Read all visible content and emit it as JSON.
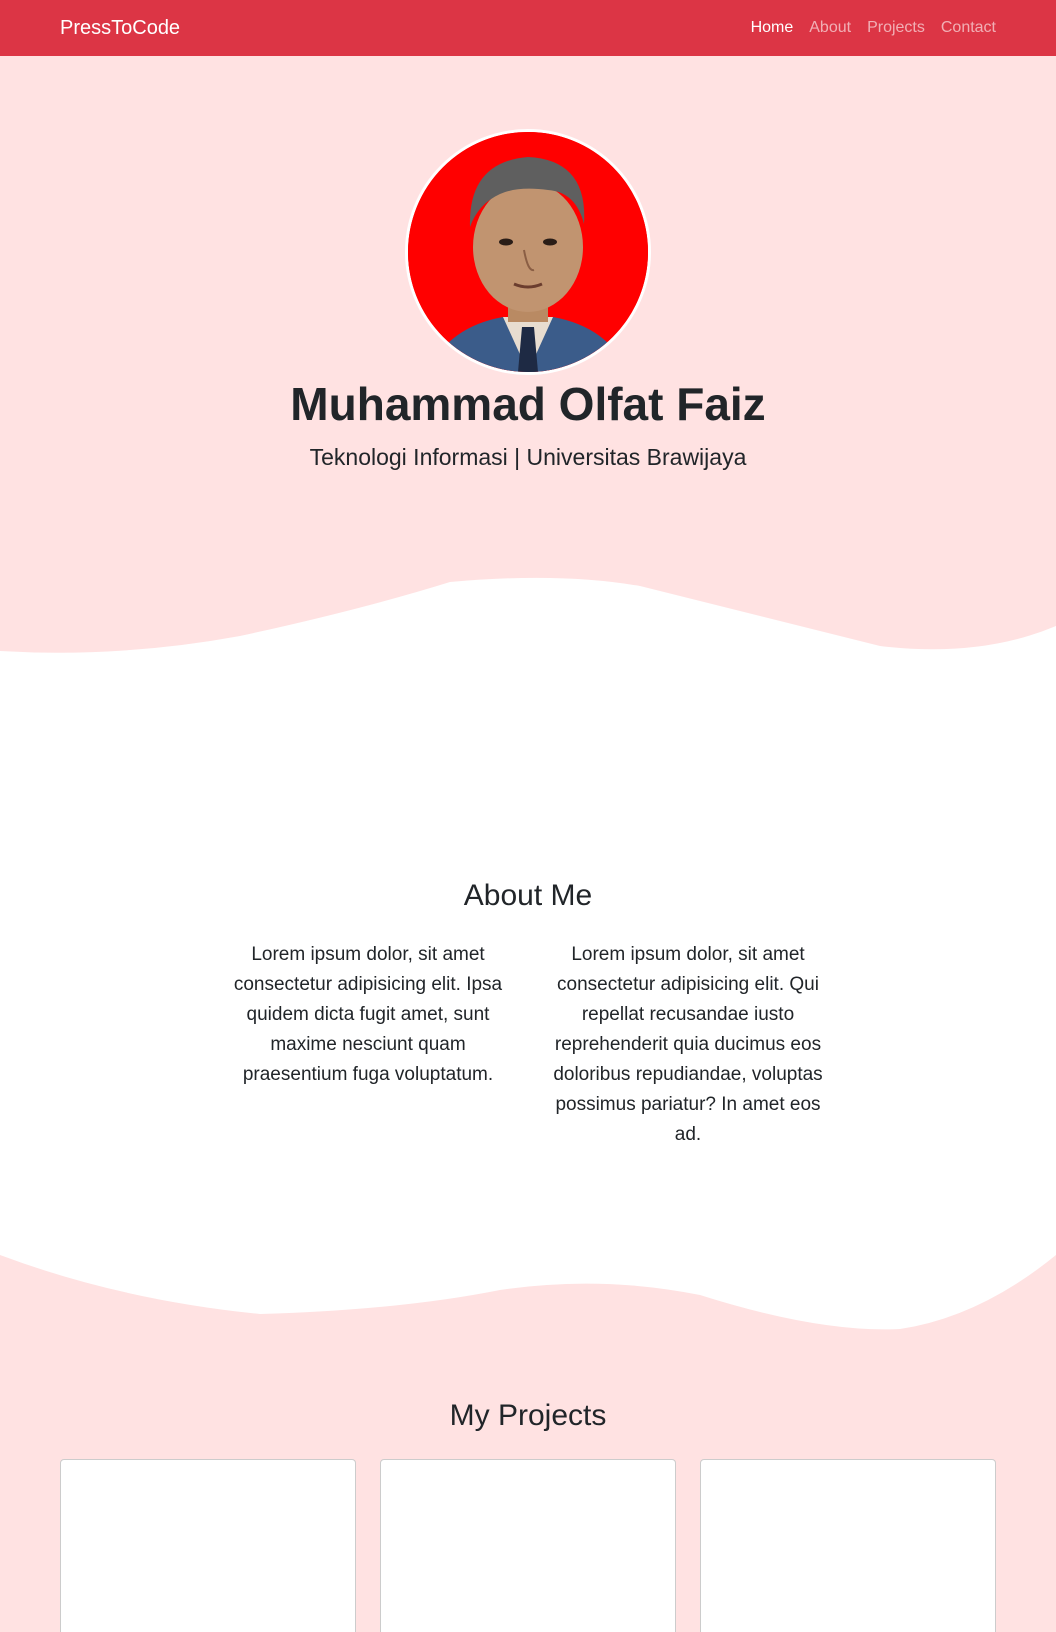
{
  "navbar": {
    "brand": "PressToCode",
    "links": [
      {
        "label": "Home",
        "active": true
      },
      {
        "label": "About",
        "active": false
      },
      {
        "label": "Projects",
        "active": false
      },
      {
        "label": "Contact",
        "active": false
      }
    ]
  },
  "hero": {
    "name": "Muhammad Olfat Faiz",
    "subtitle": "Teknologi Informasi | Universitas Brawijaya"
  },
  "about": {
    "title": "About Me",
    "col_left": "Lorem ipsum dolor, sit amet consectetur adipisicing elit. Ipsa quidem dicta fugit amet, sunt maxime nesciunt quam praesentium fuga voluptatum.",
    "col_right": "Lorem ipsum dolor, sit amet consectetur adipisicing elit. Qui repellat recusandae iusto reprehenderit quia ducimus eos doloribus repudiandae, voluptas possimus pariatur? In amet eos ad."
  },
  "projects": {
    "title": "My Projects"
  },
  "colors": {
    "navbar": "#dc3545",
    "hero_bg": "#ffe2e2",
    "avatar_bg": "#ff0000"
  }
}
